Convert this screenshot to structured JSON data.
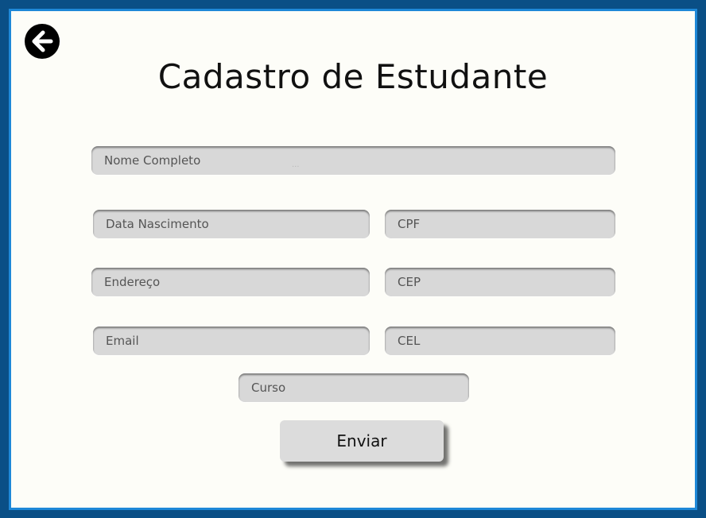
{
  "page": {
    "title": "Cadastro de Estudante"
  },
  "icons": {
    "back": "arrow-left-circle-icon"
  },
  "form": {
    "fields": {
      "nome": {
        "placeholder": "Nome Completo",
        "value": ""
      },
      "nascimento": {
        "placeholder": "Data Nascimento",
        "value": ""
      },
      "cpf": {
        "placeholder": "CPF",
        "value": ""
      },
      "endereco": {
        "placeholder": "Endereço",
        "value": ""
      },
      "cep": {
        "placeholder": "CEP",
        "value": ""
      },
      "email": {
        "placeholder": "Email",
        "value": ""
      },
      "cel": {
        "placeholder": "CEL",
        "value": ""
      },
      "curso": {
        "placeholder": "Curso",
        "value": ""
      }
    },
    "submit_label": "Enviar"
  },
  "colors": {
    "outer_background": "#0a4f86",
    "frame_border": "#1e88d8",
    "panel_background": "#fdfdf8",
    "field_background": "#d8d8d8",
    "button_background": "#dcdcdc"
  }
}
